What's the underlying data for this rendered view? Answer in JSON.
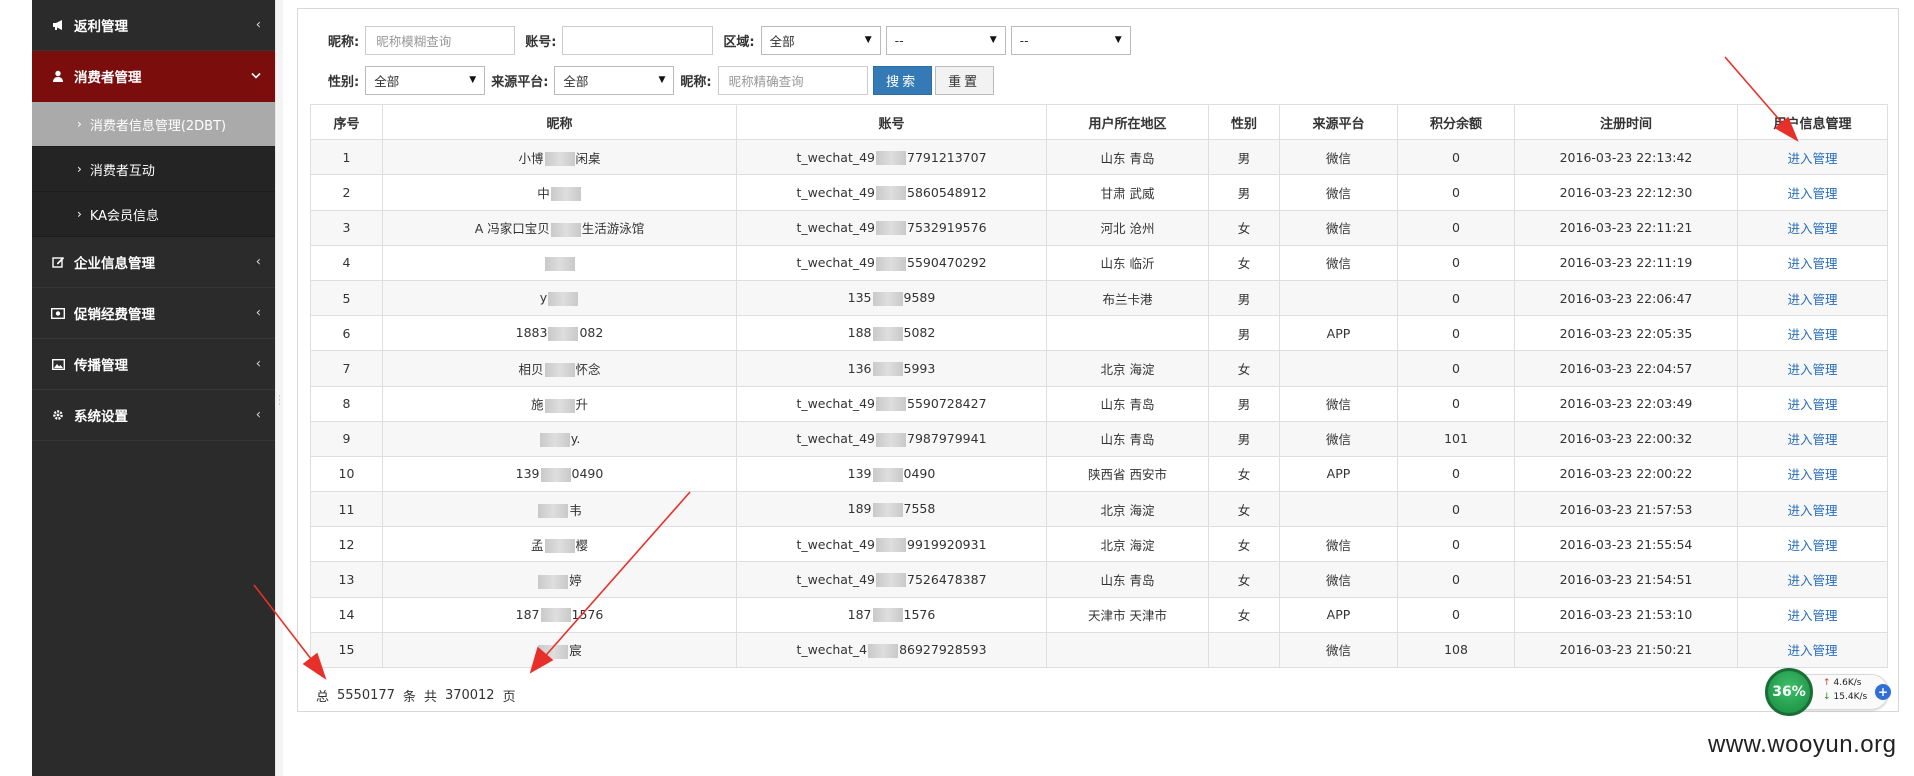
{
  "sidebar": {
    "items": [
      {
        "label": "返利管理",
        "icon": "bullhorn-icon",
        "chevron": "‹"
      },
      {
        "label": "消费者管理",
        "icon": "user-icon",
        "chevron": "⌄",
        "active": true
      },
      {
        "label": "企业信息管理",
        "icon": "edit-icon",
        "chevron": "‹"
      },
      {
        "label": "促销经费管理",
        "icon": "money-icon",
        "chevron": "‹"
      },
      {
        "label": "传播管理",
        "icon": "image-icon",
        "chevron": "‹"
      },
      {
        "label": "系统设置",
        "icon": "gear-icon",
        "chevron": "‹"
      }
    ],
    "subitems": [
      {
        "label": "消费者信息管理(2DBT)",
        "selected": true
      },
      {
        "label": "消费者互动"
      },
      {
        "label": "KA会员信息"
      }
    ],
    "bullet": "›"
  },
  "filters": {
    "nickname_label": "昵称:",
    "nickname_placeholder": "昵称模糊查询",
    "account_label": "账号:",
    "account_value": "",
    "region_label": "区域:",
    "region_value": "全部",
    "region2_value": "--",
    "region3_value": "--",
    "gender_label": "性别:",
    "gender_value": "全部",
    "platform_label": "来源平台:",
    "platform_value": "全部",
    "exact_nickname_label": "昵称:",
    "exact_nickname_placeholder": "昵称精确查询",
    "search_button": "搜索",
    "reset_button": "重置"
  },
  "table": {
    "headers": [
      "序号",
      "昵称",
      "账号",
      "用户所在地区",
      "性别",
      "来源平台",
      "积分余额",
      "注册时间",
      "用户信息管理"
    ],
    "rows": [
      {
        "no": "1",
        "nick_a": "小博",
        "nick_b": "闲桌",
        "acct_a": "t_wechat_49",
        "acct_b": "7791213707",
        "region": "山东 青岛",
        "gender": "男",
        "platform": "微信",
        "points": "0",
        "time": "2016-03-23 22:13:42",
        "action": "进入管理"
      },
      {
        "no": "2",
        "nick_a": "中",
        "nick_b": "",
        "acct_a": "t_wechat_49",
        "acct_b": "5860548912",
        "region": "甘肃 武威",
        "gender": "男",
        "platform": "微信",
        "points": "0",
        "time": "2016-03-23 22:12:30",
        "action": "进入管理"
      },
      {
        "no": "3",
        "nick_a": "A  冯家口宝贝",
        "nick_b": "生活游泳馆",
        "acct_a": "t_wechat_49",
        "acct_b": "7532919576",
        "region": "河北 沧州",
        "gender": "女",
        "platform": "微信",
        "points": "0",
        "time": "2016-03-23 22:11:21",
        "action": "进入管理"
      },
      {
        "no": "4",
        "nick_a": "",
        "nick_b": "",
        "acct_a": "t_wechat_49",
        "acct_b": "5590470292",
        "region": "山东 临沂",
        "gender": "女",
        "platform": "微信",
        "points": "0",
        "time": "2016-03-23 22:11:19",
        "action": "进入管理"
      },
      {
        "no": "5",
        "nick_a": "y",
        "nick_b": "",
        "acct_a": "135",
        "acct_b": "9589",
        "region": "布兰卡港",
        "gender": "男",
        "platform": "",
        "points": "0",
        "time": "2016-03-23 22:06:47",
        "action": "进入管理"
      },
      {
        "no": "6",
        "nick_a": "1883",
        "nick_b": "082",
        "acct_a": "188",
        "acct_b": "5082",
        "region": "",
        "gender": "男",
        "platform": "APP",
        "points": "0",
        "time": "2016-03-23 22:05:35",
        "action": "进入管理"
      },
      {
        "no": "7",
        "nick_a": "相贝",
        "nick_b": "怀念",
        "acct_a": "136",
        "acct_b": "5993",
        "region": "北京 海淀",
        "gender": "女",
        "platform": "",
        "points": "0",
        "time": "2016-03-23 22:04:57",
        "action": "进入管理"
      },
      {
        "no": "8",
        "nick_a": "施",
        "nick_b": "升",
        "acct_a": "t_wechat_49",
        "acct_b": "5590728427",
        "region": "山东 青岛",
        "gender": "男",
        "platform": "微信",
        "points": "0",
        "time": "2016-03-23 22:03:49",
        "action": "进入管理"
      },
      {
        "no": "9",
        "nick_a": "",
        "nick_b": "y.",
        "acct_a": "t_wechat_49",
        "acct_b": "7987979941",
        "region": "山东 青岛",
        "gender": "男",
        "platform": "微信",
        "points": "101",
        "time": "2016-03-23 22:00:32",
        "action": "进入管理"
      },
      {
        "no": "10",
        "nick_a": "139",
        "nick_b": "0490",
        "acct_a": "139",
        "acct_b": "0490",
        "region": "陕西省 西安市",
        "gender": "女",
        "platform": "APP",
        "points": "0",
        "time": "2016-03-23 22:00:22",
        "action": "进入管理"
      },
      {
        "no": "11",
        "nick_a": "",
        "nick_b": "韦",
        "acct_a": "189",
        "acct_b": "7558",
        "region": "北京 海淀",
        "gender": "女",
        "platform": "",
        "points": "0",
        "time": "2016-03-23 21:57:53",
        "action": "进入管理"
      },
      {
        "no": "12",
        "nick_a": "孟",
        "nick_b": "樱",
        "acct_a": "t_wechat_49",
        "acct_b": "9919920931",
        "region": "北京 海淀",
        "gender": "女",
        "platform": "微信",
        "points": "0",
        "time": "2016-03-23 21:55:54",
        "action": "进入管理"
      },
      {
        "no": "13",
        "nick_a": "",
        "nick_b": "婷",
        "acct_a": "t_wechat_49",
        "acct_b": "7526478387",
        "region": "山东 青岛",
        "gender": "女",
        "platform": "微信",
        "points": "0",
        "time": "2016-03-23 21:54:51",
        "action": "进入管理"
      },
      {
        "no": "14",
        "nick_a": "187",
        "nick_b": "1576",
        "acct_a": "187",
        "acct_b": "1576",
        "region": "天津市 天津市",
        "gender": "女",
        "platform": "APP",
        "points": "0",
        "time": "2016-03-23 21:53:10",
        "action": "进入管理"
      },
      {
        "no": "15",
        "nick_a": "",
        "nick_b": "宸",
        "acct_a": "t_wechat_4",
        "acct_b": "86927928593",
        "region": "",
        "gender": "",
        "platform": "微信",
        "points": "108",
        "time": "2016-03-23 21:50:21",
        "action": "进入管理"
      }
    ]
  },
  "footer": {
    "total_label": "总",
    "total_count": "5550177",
    "unit_label": "条",
    "pages_label": "共",
    "total_pages": "370012",
    "page_unit": "页"
  },
  "network": {
    "percent": "36%",
    "up": "4.6K/s",
    "down": "15.4K/s",
    "plus": "+"
  },
  "watermark": "www.wooyun.org",
  "colors": {
    "sidebar_bg": "#2b2b2b",
    "active_menu": "#7b0d0d",
    "link": "#2a6ebb",
    "search_button": "#337ab7",
    "arrow": "#e8302a"
  }
}
